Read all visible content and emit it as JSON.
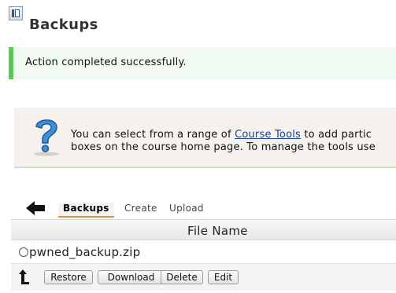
{
  "page": {
    "title": "Backups"
  },
  "notification": {
    "message": "Action completed successfully."
  },
  "info": {
    "line1_prefix": "You can select from a range of ",
    "line1_link": "Course Tools",
    "line1_suffix": " to add partic",
    "line2": "boxes on the course home page. To manage the tools use"
  },
  "tabs": [
    {
      "label": "Backups",
      "active": true
    },
    {
      "label": "Create",
      "active": false
    },
    {
      "label": "Upload",
      "active": false
    }
  ],
  "table": {
    "columns": [
      "File Name"
    ],
    "rows": [
      {
        "file_name": "pwned_backup.zip",
        "selected": false
      }
    ]
  },
  "actions": {
    "restore": "Restore",
    "download": "Download",
    "delete": "Delete",
    "edit": "Edit"
  },
  "icons": {
    "sidebar_toggle": "sidebar-toggle-icon",
    "help": "question-mark-icon",
    "back": "back-arrow-icon",
    "up": "up-arrow-icon"
  },
  "colors": {
    "success_accent": "#5ec95b",
    "success_background": "#f2fbf2",
    "info_background": "#f5f2ee",
    "link": "#1a3e9c",
    "active_tab_underline": "#e2903a"
  }
}
